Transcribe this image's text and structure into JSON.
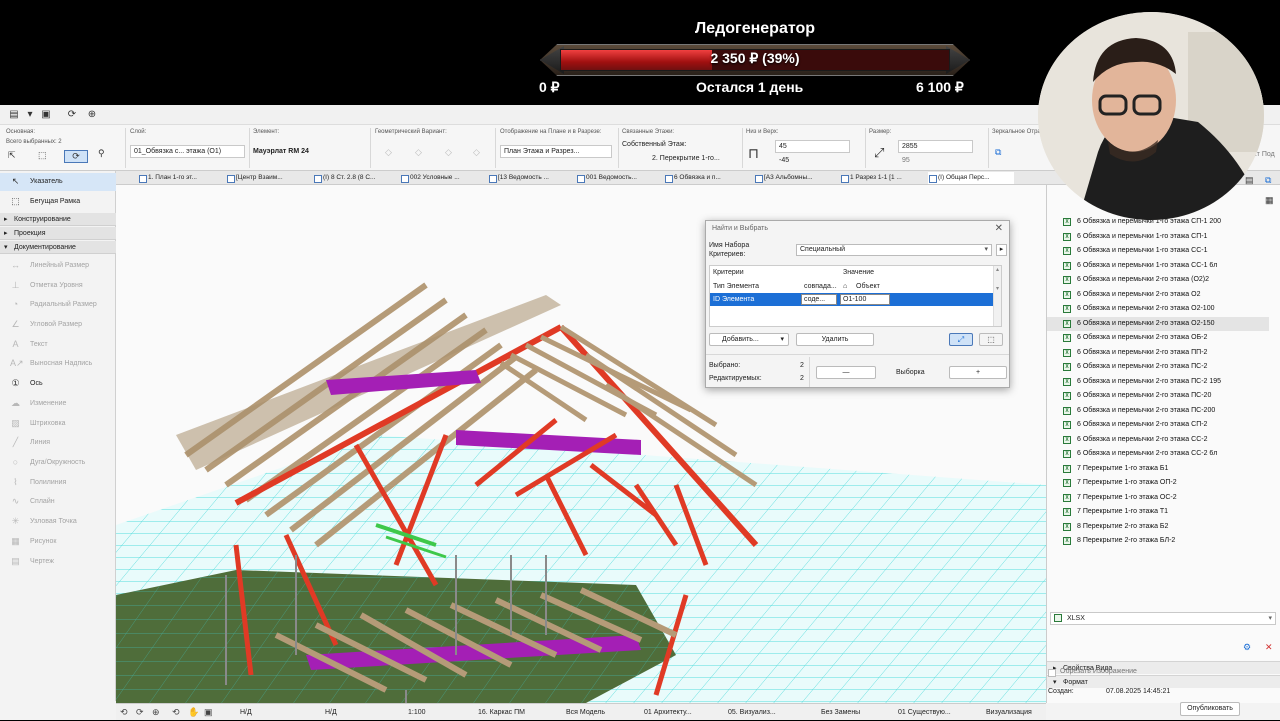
{
  "donation": {
    "title": "Ледогенератор",
    "progress_text": "2 350 ₽ (39%)",
    "progress_fraction": 0.39,
    "left_amount": "0 ₽",
    "remaining": "Остался 1 день",
    "right_amount": "6 100 ₽"
  },
  "info_box": {
    "main_label": "Основная:",
    "selected_count": "Всего выбранных: 2",
    "layer_label": "Слой:",
    "layer_value": "01_Обвязка с... этажа (О1)",
    "element_label": "Элемент:",
    "element_value": "Мауэрлат RM 24",
    "geometry_label": "Геометрический Вариант:",
    "display_label": "Отображение на Плане и в Разрезе:",
    "display_value": "План Этажа и Разрез...",
    "linked_label": "Связанные Этажи:",
    "own_floor_label": "Собственный Этаж:",
    "own_floor_value": "2. Перекрытие 1-го...",
    "bottom_top_label": "Низ и Верх:",
    "top_value": "45",
    "bottom_value": "-45",
    "size_label": "Размер:",
    "size_value_1": "2855",
    "size_value_2": "95",
    "mirror_label": "Зеркальное Отра",
    "right_clip": "ьект Под"
  },
  "tabs": [
    "1. План 1-го эт...",
    "[Центр Взаим...",
    "(I) 8 Ст. 2.8 (8 С...",
    "002 Условные ...",
    "[13 Ведомость ...",
    "001 Ведомость...",
    "6 Обвязка и п...",
    "[А3 Альбомны...",
    "1 Разрез 1-1 [1 ...",
    "(I) Общая Перс..."
  ],
  "toolbox": {
    "pointer": "Указатель",
    "marquee": "Бегущая Рамка",
    "sections": [
      "Конструирование",
      "Проекция",
      "Документирование"
    ],
    "tools": [
      "Линейный Размер",
      "Отметка Уровня",
      "Радиальный Размер",
      "Угловой Размер",
      "Текст",
      "Выносная Надпись",
      "Ось",
      "Изменение",
      "Штриховка",
      "Линия",
      "Дуга/Окружность",
      "Полилиния",
      "Сплайн",
      "Узловая Точка",
      "Рисунок",
      "Чертеж"
    ]
  },
  "find_dialog": {
    "title": "Найти и Выбрать",
    "set_label_1": "Имя Набора",
    "set_label_2": "Критериев:",
    "set_value": "Специальный",
    "col_criteria": "Критерии",
    "col_value": "Значение",
    "row1_criteria": "Тип Элемента",
    "row1_op": "совпада...",
    "row1_value": "Объект",
    "row2_criteria": "ID Элемента",
    "row2_op": "соде...",
    "row2_value": "О1-100",
    "add_button": "Добавить...",
    "delete_button": "Удалить",
    "selected_label": "Выбрано:",
    "selected_count": "2",
    "editable_label": "Редактируемых:",
    "editable_count": "2",
    "minus_button": "—",
    "selection_label": "Выборка",
    "plus_button": "+"
  },
  "right_panel": {
    "items": [
      "6 Обвязка и перемычки 1-го этажа СП-1 200",
      "6 Обвязка и перемычки 1-го этажа СП-1",
      "6 Обвязка и перемычки 1-го этажа СС-1",
      "6 Обвязка и перемычки 1-го этажа СС-1 6л",
      "6 Обвязка и перемычки 2-го этажа (О2)2",
      "6 Обвязка и перемычки 2-го этажа О2",
      "6 Обвязка и перемычки 2-го этажа О2-100",
      "6 Обвязка и перемычки 2-го этажа О2-150",
      "6 Обвязка и перемычки 2-го этажа ОБ-2",
      "6 Обвязка и перемычки 2-го этажа ПП-2",
      "6 Обвязка и перемычки 2-го этажа ПС-2",
      "6 Обвязка и перемычки 2-го этажа ПС-2 195",
      "6 Обвязка и перемычки 2-го этажа ПС-20",
      "6 Обвязка и перемычки 2-го этажа ПС-200",
      "6 Обвязка и перемычки 2-го этажа СП-2",
      "6 Обвязка и перемычки 2-го этажа СС-2",
      "6 Обвязка и перемычки 2-го этажа СС-2 6л",
      "7 Перекрытие 1-го этажа Б1",
      "7 Перекрытие 1-го этажа ОП-2",
      "7 Перекрытие 1-го этажа ОС-2",
      "7 Перекрытие 1-го этажа Т1",
      "8 Перекрытие 2-го этажа Б2",
      "8 Перекрытие 2-го этажа БЛ-2"
    ],
    "selected_index": 7,
    "view_props": "Свойства Вида",
    "format_section": "Формат",
    "format_value": "XLSX",
    "crop_label": "Обрезать Изображение",
    "created_label": "Создан:",
    "created_value": "07.08.2025 14:45:21",
    "publish": "Опубликовать"
  },
  "status_bar": {
    "nd1": "Н/Д",
    "nd2": "Н/Д",
    "scale": "1:100",
    "model": "16. Каркас ПМ",
    "whole_model": "Вся Модель",
    "arch": "01 Архитекту...",
    "visual": "05. Визуализ...",
    "no_replace": "Без Замены",
    "existing": "01 Существую...",
    "visualization": "Визуализация"
  },
  "colors": {
    "accent": "#1c6fd6",
    "progress_red": "#d02020",
    "beam_red": "#e03a25",
    "beam_magenta": "#a41fb5",
    "ground_green": "#4f6d3a",
    "grid_cyan": "#39d6d6"
  }
}
